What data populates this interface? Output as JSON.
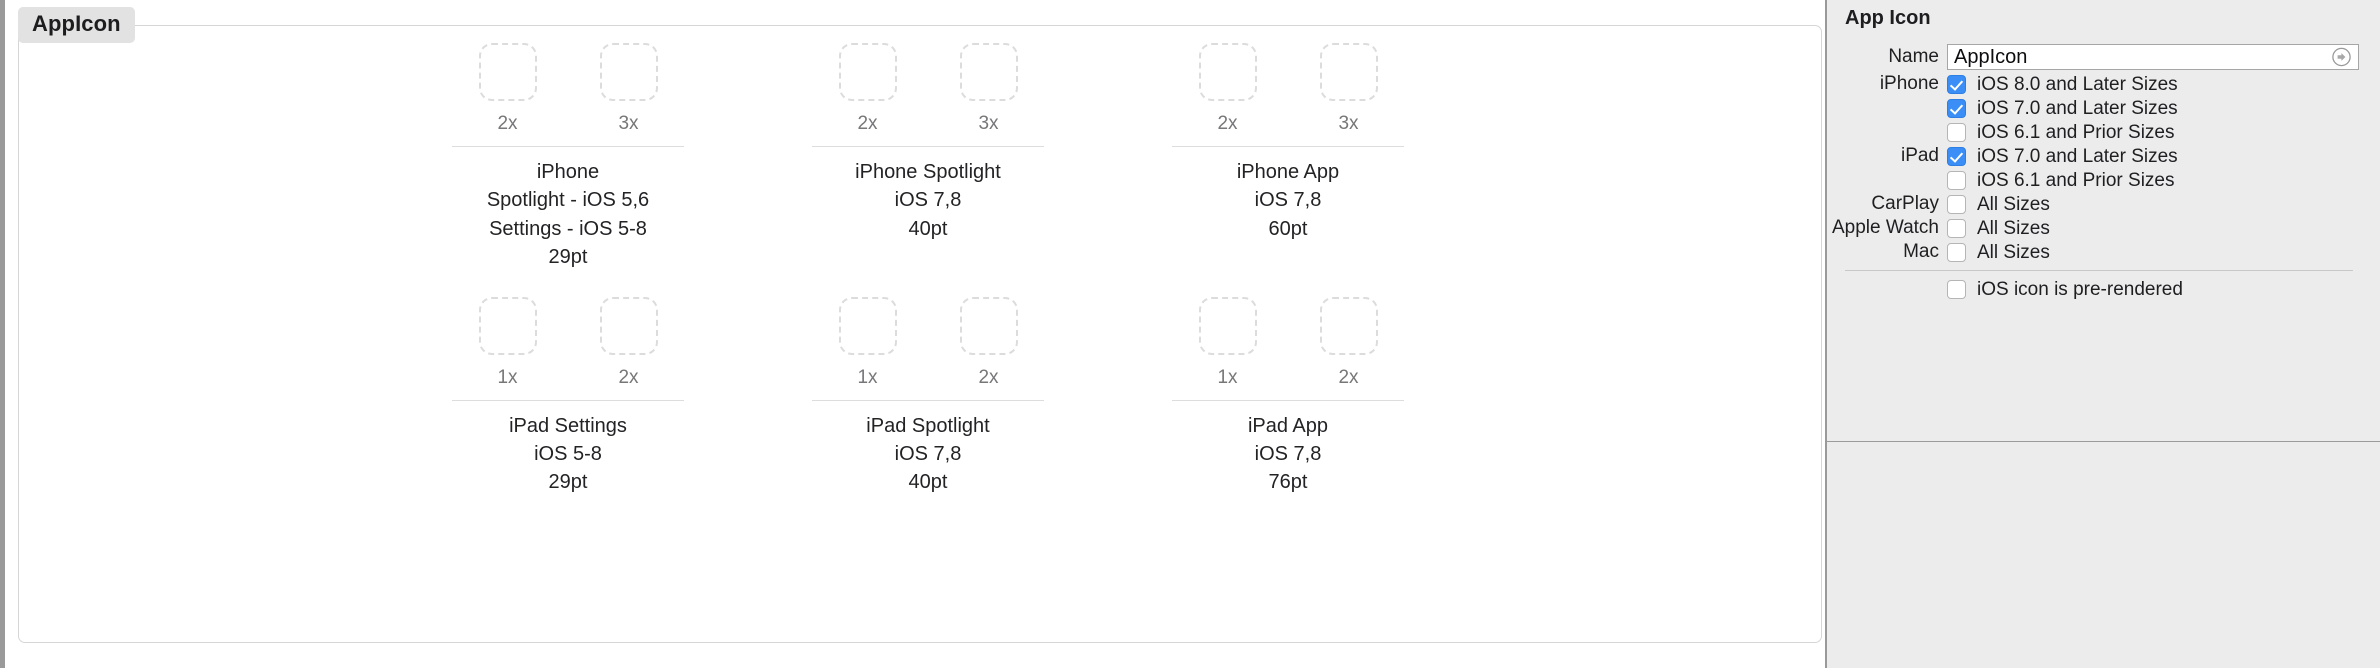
{
  "editor": {
    "tab_label": "AppIcon",
    "icon_sets": [
      {
        "slots": [
          {
            "scale": "2x"
          },
          {
            "scale": "3x"
          }
        ],
        "caption": [
          "iPhone",
          "Spotlight - iOS 5,6",
          "Settings - iOS 5-8",
          "29pt"
        ]
      },
      {
        "slots": [
          {
            "scale": "2x"
          },
          {
            "scale": "3x"
          }
        ],
        "caption": [
          "iPhone Spotlight",
          "iOS 7,8",
          "40pt"
        ]
      },
      {
        "slots": [
          {
            "scale": "2x"
          },
          {
            "scale": "3x"
          }
        ],
        "caption": [
          "iPhone App",
          "iOS 7,8",
          "60pt"
        ]
      },
      {
        "slots": [
          {
            "scale": "1x"
          },
          {
            "scale": "2x"
          }
        ],
        "caption": [
          "iPad Settings",
          "iOS 5-8",
          "29pt"
        ]
      },
      {
        "slots": [
          {
            "scale": "1x"
          },
          {
            "scale": "2x"
          }
        ],
        "caption": [
          "iPad Spotlight",
          "iOS 7,8",
          "40pt"
        ]
      },
      {
        "slots": [
          {
            "scale": "1x"
          },
          {
            "scale": "2x"
          }
        ],
        "caption": [
          "iPad App",
          "iOS 7,8",
          "76pt"
        ]
      }
    ]
  },
  "inspector": {
    "title": "App Icon",
    "name_label": "Name",
    "name_value": "AppIcon",
    "disclosure_icon": "circle-arrow-right-icon",
    "rows": [
      {
        "label": "iPhone",
        "checked": true,
        "text": "iOS 8.0 and Later Sizes"
      },
      {
        "label": "",
        "checked": true,
        "text": "iOS 7.0 and Later Sizes"
      },
      {
        "label": "",
        "checked": false,
        "text": "iOS 6.1 and Prior Sizes"
      },
      {
        "label": "iPad",
        "checked": true,
        "text": "iOS 7.0 and Later Sizes"
      },
      {
        "label": "",
        "checked": false,
        "text": "iOS 6.1 and Prior Sizes"
      },
      {
        "label": "CarPlay",
        "checked": false,
        "text": "All Sizes"
      },
      {
        "label": "Apple Watch",
        "checked": false,
        "text": "All Sizes"
      },
      {
        "label": "Mac",
        "checked": false,
        "text": "All Sizes"
      }
    ],
    "prerendered": {
      "label": "",
      "checked": false,
      "text": "iOS icon is pre-rendered"
    },
    "colors": {
      "checkbox_on": "#3a8ef6",
      "panel_bg": "#ececec",
      "canvas_bg": "#ffffff",
      "placeholder_border": "#dcdcdc"
    }
  }
}
